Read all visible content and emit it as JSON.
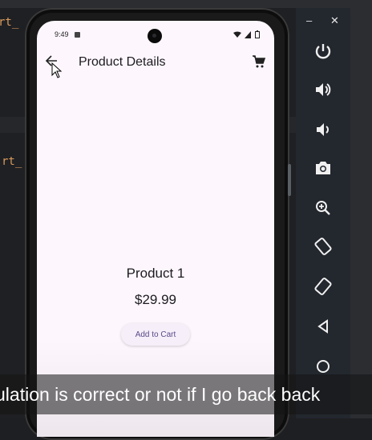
{
  "ide": {
    "code_fragment_1": "rt_",
    "code_fragment_2": "rt_"
  },
  "status_bar": {
    "time": "9:49"
  },
  "app_bar": {
    "title": "Product Details",
    "back_icon": "arrow-back-icon",
    "cart_icon": "shopping-cart-icon"
  },
  "product": {
    "name": "Product 1",
    "price": "$29.99",
    "add_to_cart_label": "Add to Cart"
  },
  "emulator_toolbar": {
    "minimize_label": "–",
    "close_label": "✕",
    "buttons": [
      "power-icon",
      "volume-up-icon",
      "volume-down-icon",
      "camera-icon",
      "zoom-icon",
      "rotate-left-icon",
      "rotate-right-icon",
      "back-icon",
      "home-icon"
    ]
  },
  "caption": {
    "text": "ulation is correct or not if I go back back"
  }
}
